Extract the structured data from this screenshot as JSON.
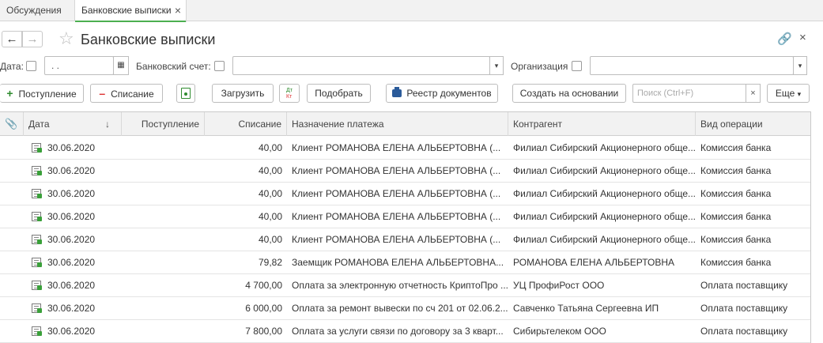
{
  "tabs": [
    {
      "label": "Обсуждения"
    },
    {
      "label": "Банковские выписки",
      "close": "×"
    }
  ],
  "header": {
    "back": "←",
    "forward": "→",
    "title": "Банковские выписки",
    "link": "🔗",
    "close": "×"
  },
  "filters": {
    "date_label": "Дата:",
    "date_value": " .  .",
    "bank_account_label": "Банковский счет:",
    "bank_account_value": "",
    "organization_label": "Организация",
    "organization_value": ""
  },
  "toolbar": {
    "receipt_label": "Поступление",
    "writeoff_label": "Списание",
    "load_label": "Загрузить",
    "select_label": "Подобрать",
    "registry_label": "Реестр документов",
    "create_based_label": "Создать на основании",
    "search_placeholder": "Поиск (Ctrl+F)",
    "search_clear": "×",
    "more_label": "Еще"
  },
  "table": {
    "columns": [
      "Дата",
      "Поступление",
      "Списание",
      "Назначение платежа",
      "Контрагент",
      "Вид операции"
    ],
    "sort_indicator": "↓",
    "rows": [
      {
        "date": "30.06.2020",
        "receipt": "",
        "writeoff": "40,00",
        "purpose": "Клиент РОМАНОВА ЕЛЕНА АЛЬБЕРТОВНА (...",
        "counterparty": "Филиал Сибирский Акционерного обще...",
        "operation": "Комиссия банка"
      },
      {
        "date": "30.06.2020",
        "receipt": "",
        "writeoff": "40,00",
        "purpose": "Клиент РОМАНОВА ЕЛЕНА АЛЬБЕРТОВНА (...",
        "counterparty": "Филиал Сибирский Акционерного обще...",
        "operation": "Комиссия банка"
      },
      {
        "date": "30.06.2020",
        "receipt": "",
        "writeoff": "40,00",
        "purpose": "Клиент РОМАНОВА ЕЛЕНА АЛЬБЕРТОВНА (...",
        "counterparty": "Филиал Сибирский Акционерного обще...",
        "operation": "Комиссия банка"
      },
      {
        "date": "30.06.2020",
        "receipt": "",
        "writeoff": "40,00",
        "purpose": "Клиент РОМАНОВА ЕЛЕНА АЛЬБЕРТОВНА (...",
        "counterparty": "Филиал Сибирский Акционерного обще...",
        "operation": "Комиссия банка"
      },
      {
        "date": "30.06.2020",
        "receipt": "",
        "writeoff": "40,00",
        "purpose": "Клиент РОМАНОВА ЕЛЕНА АЛЬБЕРТОВНА (...",
        "counterparty": "Филиал Сибирский Акционерного обще...",
        "operation": "Комиссия банка"
      },
      {
        "date": "30.06.2020",
        "receipt": "",
        "writeoff": "79,82",
        "purpose": "Заемщик РОМАНОВА ЕЛЕНА АЛЬБЕРТОВНА...",
        "counterparty": "РОМАНОВА ЕЛЕНА АЛЬБЕРТОВНА",
        "operation": "Комиссия банка"
      },
      {
        "date": "30.06.2020",
        "receipt": "",
        "writeoff": "4 700,00",
        "purpose": "Оплата за электронную отчетность КриптоПро ...",
        "counterparty": "УЦ ПрофиРост ООО",
        "operation": "Оплата поставщику"
      },
      {
        "date": "30.06.2020",
        "receipt": "",
        "writeoff": "6 000,00",
        "purpose": "Оплата за ремонт вывески по сч 201 от 02.06.2...",
        "counterparty": "Савченко Татьяна Сергеевна ИП",
        "operation": "Оплата поставщику"
      },
      {
        "date": "30.06.2020",
        "receipt": "",
        "writeoff": "7 800,00",
        "purpose": "Оплата за услуги связи по договору за 3 кварт...",
        "counterparty": "Сибирьтелеком ООО",
        "operation": "Оплата поставщику"
      }
    ]
  }
}
